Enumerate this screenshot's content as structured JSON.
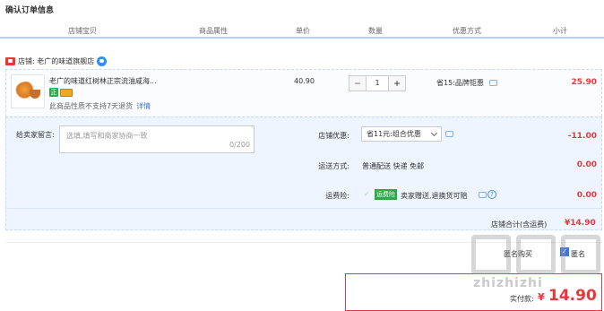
{
  "page": {
    "title": "确认订单信息"
  },
  "header": {
    "columns": [
      "店铺宝贝",
      "商品属性",
      "单价",
      "数量",
      "优惠方式",
      "小计"
    ]
  },
  "shop": {
    "label": "店铺: 老广的味道旗舰店"
  },
  "item": {
    "title": "老广的味道红树林正宗流油咸海...",
    "badge_green": "正",
    "note": "此商品性质不支持7天退货",
    "note_link": "详情",
    "unit_price": "40.90",
    "quantity": "1",
    "promo": "省15:品牌钜惠",
    "subtotal": "25.90"
  },
  "order": {
    "message_label": "给卖家留言:",
    "message_placeholder": "选填,填写和商家协商一致",
    "message_counter": "0/200",
    "shop_discount_label": "店铺优惠:",
    "shop_discount_selected": "省11元:组合优惠",
    "shop_discount_amount": "-11.00",
    "shipping_label": "运送方式:",
    "shipping_text": "普通配送 快递 免邮",
    "shipping_amount": "0.00",
    "insurance_label": "运费险:",
    "insurance_badge": "运费险",
    "insurance_text": "卖家赠送,退换货可赔",
    "insurance_amount": "0.00",
    "total_label": "店铺合计(含运费)",
    "total_amount": "¥14.90"
  },
  "options": {
    "anon_label": "匿名购买",
    "anon_text": "匿名"
  },
  "payment": {
    "label": "实付款:",
    "symbol": "¥",
    "amount": "14.90"
  },
  "watermark": {
    "text": "zhizhizhi"
  },
  "colors": {
    "accent_red": "#e4393c",
    "link_blue": "#3c78d8",
    "header_border": "#b2d1ff"
  }
}
